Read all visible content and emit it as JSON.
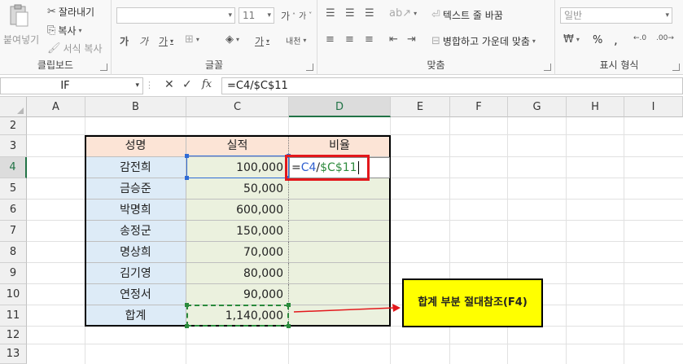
{
  "ribbon": {
    "clipboard": {
      "group_label": "클립보드",
      "paste_label": "붙여넣기",
      "cut_label": "잘라내기",
      "copy_label": "복사",
      "format_painter_label": "서식 복사"
    },
    "font": {
      "group_label": "글꼴",
      "font_name": "",
      "font_size": "11",
      "grow_label": "가",
      "shrink_label": "가",
      "bold_label": "가",
      "italic_label": "가",
      "underline_label": "가",
      "font_color_label": "가",
      "phonetic_label": "내천"
    },
    "alignment": {
      "group_label": "맞춤",
      "wrap_label": "텍스트 줄 바꿈",
      "merge_label": "병합하고 가운데 맞춤"
    },
    "number": {
      "group_label": "표시 형식",
      "format_value": "일반",
      "percent": "%",
      "comma": ","
    }
  },
  "formula_bar": {
    "name_box": "IF",
    "formula": "=C4/$C$11",
    "fx_label": "fx"
  },
  "columns": [
    "A",
    "B",
    "C",
    "D",
    "E",
    "F",
    "G",
    "H",
    "I"
  ],
  "rows": [
    "2",
    "3",
    "4",
    "5",
    "6",
    "7",
    "8",
    "9",
    "10",
    "11",
    "12",
    "13"
  ],
  "table": {
    "headers": [
      "성명",
      "실적",
      "비율"
    ],
    "names": [
      "감전희",
      "금승준",
      "박명희",
      "송정군",
      "명상희",
      "김기영",
      "연정서"
    ],
    "values": [
      "100,000",
      "50,000",
      "600,000",
      "150,000",
      "70,000",
      "80,000",
      "90,000"
    ],
    "total_label": "합계",
    "total_value": "1,140,000"
  },
  "editing_cell": {
    "prefix": "=",
    "ref1": "C4",
    "slash": "/",
    "ref2": "$C$11"
  },
  "callout": {
    "text": "합계 부분 절대참조(F4)"
  },
  "colors": {
    "header_fill": "#fce4d6",
    "name_fill": "#ddebf7",
    "value_fill": "#ebf1de",
    "highlight_red": "#e3171b",
    "callout_fill": "#ffff00"
  }
}
